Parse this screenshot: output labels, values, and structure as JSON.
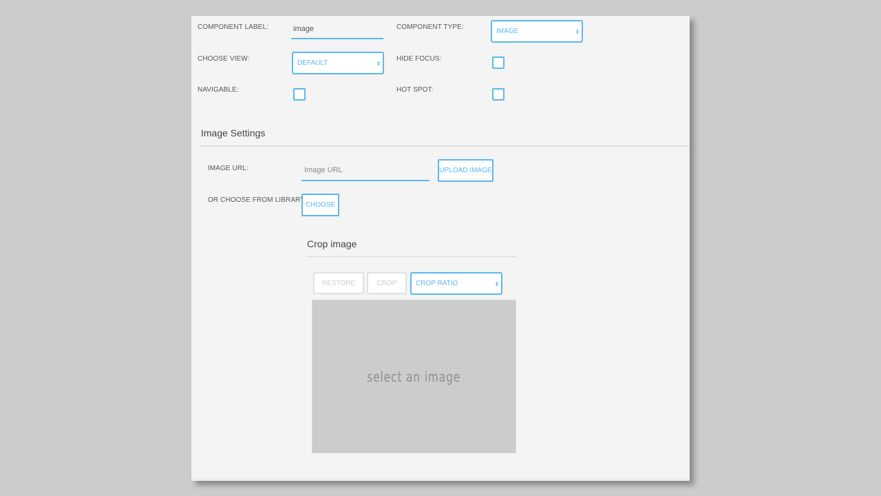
{
  "component": {
    "label_caption": "COMPONENT LABEL:",
    "label_value": "image",
    "type_caption": "COMPONENT TYPE:",
    "type_value": "IMAGE",
    "view_caption": "CHOOSE VIEW:",
    "view_value": "DEFAULT",
    "hide_focus_caption": "HIDE FOCUS:",
    "hide_focus_checked": false,
    "navigable_caption": "NAVIGABLE:",
    "navigable_checked": false,
    "hot_spot_caption": "HOT SPOT:",
    "hot_spot_checked": false
  },
  "image_settings": {
    "title": "Image Settings",
    "url_caption": "IMAGE URL:",
    "url_value": "",
    "url_placeholder": "Image URL",
    "upload_label": "UPLOAD IMAGE",
    "library_caption": "OR CHOOSE FROM LIBRARY",
    "choose_label": "CHOOSE"
  },
  "crop": {
    "title": "Crop image",
    "restore_label": "RESTORE",
    "crop_label": "CROP",
    "ratio_value": "CROP RATIO",
    "placeholder_text": "select an image"
  },
  "colors": {
    "accent": "#5bb8ee",
    "panel_bg": "#f4f4f4",
    "page_bg": "#cccccc",
    "disabled_border": "#dde2e6"
  }
}
